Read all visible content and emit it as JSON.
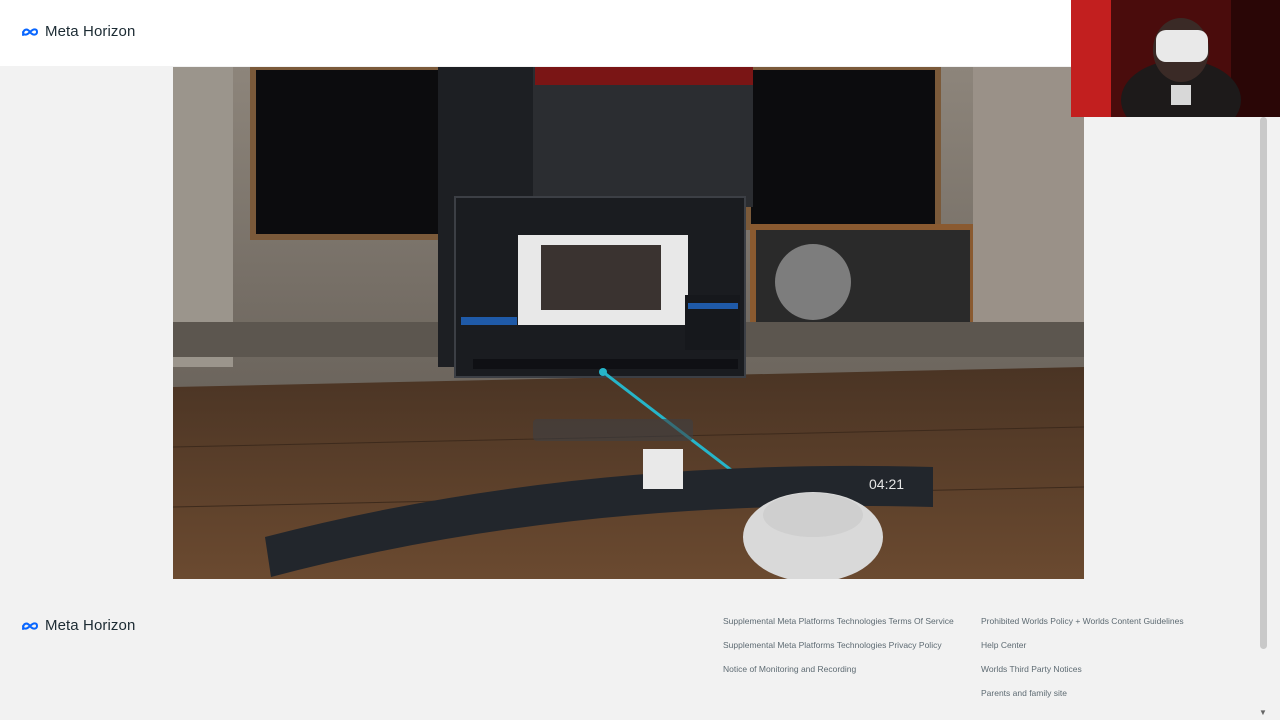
{
  "brand": {
    "name": "Meta Horizon",
    "color": "#0866ff"
  },
  "video": {
    "clock": "04:21",
    "taskbar_icons": [
      "menu-icon",
      "avatar-icon",
      "volume-icon",
      "steam-icon",
      "share-icon",
      "monitor-icon",
      "monitor-icon",
      "monitor-active-icon",
      "monitor-icon",
      "plus-icon",
      "bell-icon",
      "headset-icon",
      "battery-icon"
    ]
  },
  "footer": {
    "links_col1": [
      "Supplemental Meta Platforms Technologies Terms Of Service",
      "Supplemental Meta Platforms Technologies Privacy Policy",
      "Notice of Monitoring and Recording"
    ],
    "links_col2": [
      "Prohibited Worlds Policy + Worlds Content Guidelines",
      "Help Center",
      "Worlds Third Party Notices",
      "Parents and family site"
    ]
  }
}
